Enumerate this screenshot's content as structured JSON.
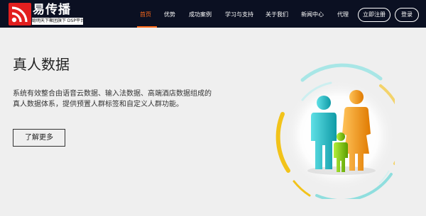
{
  "brand": {
    "name": "易传播",
    "tagline": "聪明天下聚团旗下 DSP平台",
    "accent": "#e21f1f"
  },
  "nav": {
    "items": [
      {
        "label": "首页",
        "active": true
      },
      {
        "label": "优势",
        "active": false
      },
      {
        "label": "成功案例",
        "active": false
      },
      {
        "label": "学习与支持",
        "active": false
      },
      {
        "label": "关于我们",
        "active": false
      },
      {
        "label": "新闻中心",
        "active": false
      },
      {
        "label": "代理",
        "active": false
      }
    ],
    "register_label": "立即注册",
    "login_label": "登录",
    "active_color": "#ff6a1a"
  },
  "hero": {
    "title": "真人数据",
    "description": "系统有效整合由语音云数据、输入法数据、高端酒店数据组成的真人数据体系，提供预置人群标签和自定义人群功能。",
    "button_label": "了解更多"
  },
  "illustration": {
    "icon": "people-group-icon",
    "colors": {
      "adult_male": "#17b8c0",
      "child": "#7cc400",
      "adult_female": "#f29a12",
      "ring_yellow": "#f2c31a",
      "ring_cyan": "#7fd8d8"
    }
  }
}
